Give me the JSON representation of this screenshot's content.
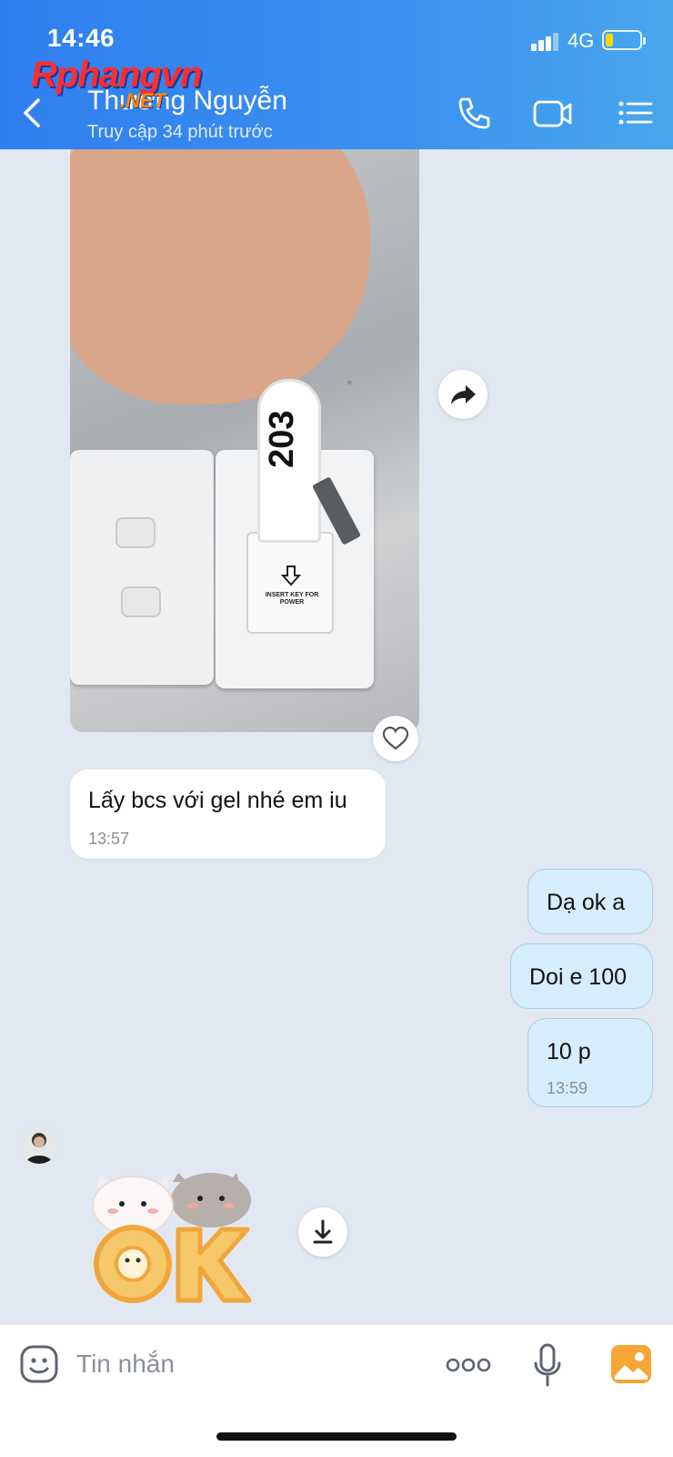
{
  "status_bar": {
    "time": "14:46",
    "network": "4G"
  },
  "watermark": {
    "main": "Rphangvn",
    "sub": ".NET"
  },
  "header": {
    "contact_name": "Thương Nguyễn",
    "status": "Truy cập 34 phút trước"
  },
  "photo": {
    "room_number": "203",
    "slot_label": "INSERT KEY FOR POWER"
  },
  "messages": [
    {
      "direction": "in",
      "text": "Lấy bcs với gel nhé em iu",
      "time": "13:57"
    },
    {
      "direction": "out",
      "text": "Dạ ok a"
    },
    {
      "direction": "out",
      "text": "Doi e 100"
    },
    {
      "direction": "out",
      "text": "10 p",
      "time": "13:59"
    }
  ],
  "input": {
    "placeholder": "Tin nhắn"
  },
  "colors": {
    "header_start": "#2f7ef0",
    "header_end": "#48a6ee",
    "outgoing_bubble": "#d5edfd",
    "chat_bg": "#e2e8f1",
    "image_button": "#f7a534"
  }
}
